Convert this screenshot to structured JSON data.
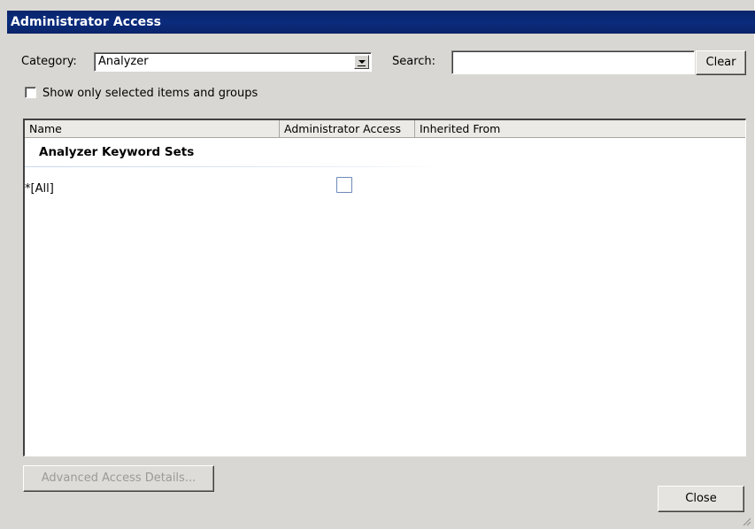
{
  "window": {
    "title": "Administrator Access"
  },
  "toolbar": {
    "category_label": "Category:",
    "category_value": "Analyzer",
    "search_label": "Search:",
    "search_value": "",
    "clear_label": "Clear"
  },
  "filter": {
    "show_selected_label": "Show only selected items and groups",
    "show_selected_checked": false
  },
  "list": {
    "columns": [
      "Name",
      "Administrator Access",
      "Inherited From"
    ],
    "group_title": "Analyzer Keyword Sets",
    "rows": [
      {
        "name": "*[All]",
        "administrator_access": false,
        "inherited_from": ""
      }
    ]
  },
  "footer": {
    "advanced_label": "Advanced Access Details...",
    "close_label": "Close"
  },
  "icons": {
    "combo_arrow": "chevron-down-icon",
    "resize_grip": "resize-grip-icon"
  }
}
